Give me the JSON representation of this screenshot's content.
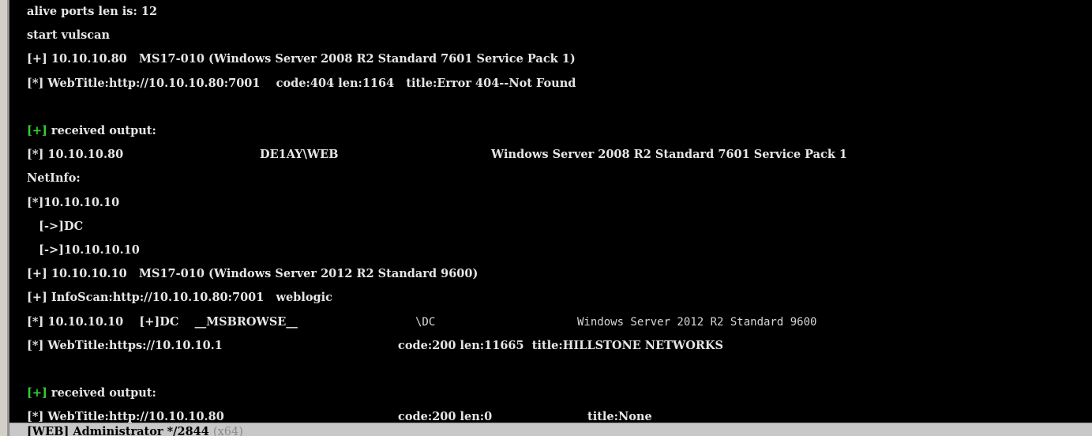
{
  "console": {
    "lines": [
      {
        "segments": [
          {
            "text": "alive ports len is: 12"
          }
        ]
      },
      {
        "segments": [
          {
            "text": "start vulscan"
          }
        ]
      },
      {
        "segments": [
          {
            "text": "[+] 10.10.10.80   MS17-010 (Windows Server 2008 R2 Standard 7601 Service Pack 1)"
          }
        ]
      },
      {
        "segments": [
          {
            "text": "[*] WebTitle:http://10.10.10.80:7001    code:404 len:1164   title:Error 404--Not Found"
          }
        ]
      },
      {
        "segments": []
      },
      {
        "segments": [
          {
            "text": "[+]",
            "style": "green"
          },
          {
            "text": " received output:"
          }
        ]
      },
      {
        "segments": [
          {
            "text": "[*] 10.10.10.80"
          },
          {
            "text": "DE1AY\\WEB"
          },
          {
            "text": "Windows Server 2008 R2 Standard 7601 Service Pack 1"
          }
        ]
      },
      {
        "segments": [
          {
            "text": "NetInfo:"
          }
        ]
      },
      {
        "segments": [
          {
            "text": "[*]10.10.10.10"
          }
        ]
      },
      {
        "segments": [
          {
            "text": "   [->]DC"
          }
        ]
      },
      {
        "segments": [
          {
            "text": "   [->]10.10.10.10"
          }
        ]
      },
      {
        "segments": [
          {
            "text": "[+] 10.10.10.10   MS17-010 (Windows Server 2012 R2 Standard 9600)"
          }
        ]
      },
      {
        "segments": [
          {
            "text": "[+] InfoScan:http://10.10.10.80:7001   weblogic"
          }
        ]
      },
      {
        "segments": [
          {
            "text": "[*] 10.10.10.10    [+]DC    __MSBROWSE__"
          },
          {
            "text": "\\DC",
            "style": "thin"
          },
          {
            "text": "Windows Server 2012 R2 Standard 9600",
            "style": "thin"
          }
        ]
      },
      {
        "segments": [
          {
            "text": "[*] WebTitle:https://10.10.10.1"
          },
          {
            "text": "code:200 len:11665  title:HILLSTONE NETWORKS"
          }
        ]
      },
      {
        "segments": []
      },
      {
        "segments": [
          {
            "text": "[+]",
            "style": "green"
          },
          {
            "text": " received output:"
          }
        ]
      },
      {
        "segments": [
          {
            "text": "[*] WebTitle:http://10.10.10.80"
          },
          {
            "text": "code:200 len:0"
          },
          {
            "text": "title:None"
          }
        ]
      }
    ]
  },
  "statusbar": {
    "session": "[WEB] Administrator */2844",
    "arch": "(x64)"
  }
}
